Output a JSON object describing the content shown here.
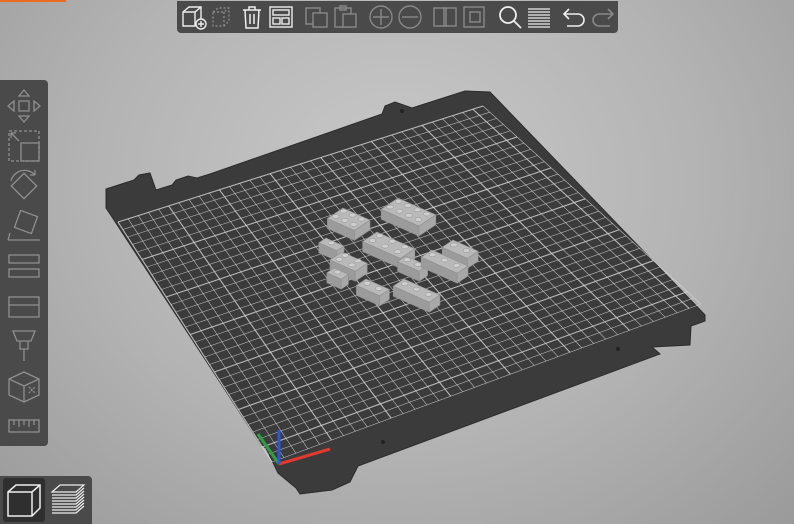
{
  "app": {
    "accent_color": "#ed6b21"
  },
  "toolbar": {
    "buttons": [
      {
        "name": "add-button",
        "icon": "add-cube-icon",
        "enabled": true
      },
      {
        "name": "delete-button",
        "icon": "delete-icon",
        "enabled": false
      },
      {
        "name": "delete-all-button",
        "icon": "trash-icon",
        "enabled": true
      },
      {
        "name": "arrange-button",
        "icon": "arrange-icon",
        "enabled": true
      },
      {
        "name": "copy-button",
        "icon": "copy-icon",
        "enabled": false
      },
      {
        "name": "paste-button",
        "icon": "paste-icon",
        "enabled": false
      },
      {
        "name": "add-instance-button",
        "icon": "plus-circle-icon",
        "enabled": false
      },
      {
        "name": "remove-instance-button",
        "icon": "minus-circle-icon",
        "enabled": false
      },
      {
        "name": "split-objects-button",
        "icon": "split-objects-icon",
        "enabled": false
      },
      {
        "name": "split-parts-button",
        "icon": "split-parts-icon",
        "enabled": false
      },
      {
        "name": "search-button",
        "icon": "search-icon",
        "enabled": true
      },
      {
        "name": "layer-editing-button",
        "icon": "layers-icon",
        "enabled": true
      },
      {
        "name": "undo-button",
        "icon": "undo-icon",
        "enabled": true
      },
      {
        "name": "redo-button",
        "icon": "redo-icon",
        "enabled": false
      }
    ]
  },
  "sidebar": {
    "tools": [
      {
        "name": "move-tool",
        "icon": "move-icon"
      },
      {
        "name": "scale-tool",
        "icon": "scale-icon"
      },
      {
        "name": "rotate-tool",
        "icon": "rotate-icon"
      },
      {
        "name": "place-on-face-tool",
        "icon": "place-on-face-icon"
      },
      {
        "name": "cut-tool",
        "icon": "cut-icon"
      },
      {
        "name": "hollow-tool",
        "icon": "hollow-icon"
      },
      {
        "name": "paint-tool",
        "icon": "paint-icon"
      },
      {
        "name": "seam-tool",
        "icon": "seam-icon"
      },
      {
        "name": "measure-tool",
        "icon": "ruler-icon"
      }
    ]
  },
  "view_switch": {
    "active": "3d",
    "buttons": [
      {
        "name": "3d-view-button",
        "icon": "cube-view-icon"
      },
      {
        "name": "preview-button",
        "icon": "layers-preview-icon"
      }
    ]
  },
  "scene": {
    "bed_color": "#3b3b3b",
    "grid_color": "#d9d9d9",
    "model_color": "#b9b9b9",
    "axis_colors": {
      "x": "#e03a2e",
      "y": "#2ea043",
      "z": "#2e55d6"
    }
  }
}
